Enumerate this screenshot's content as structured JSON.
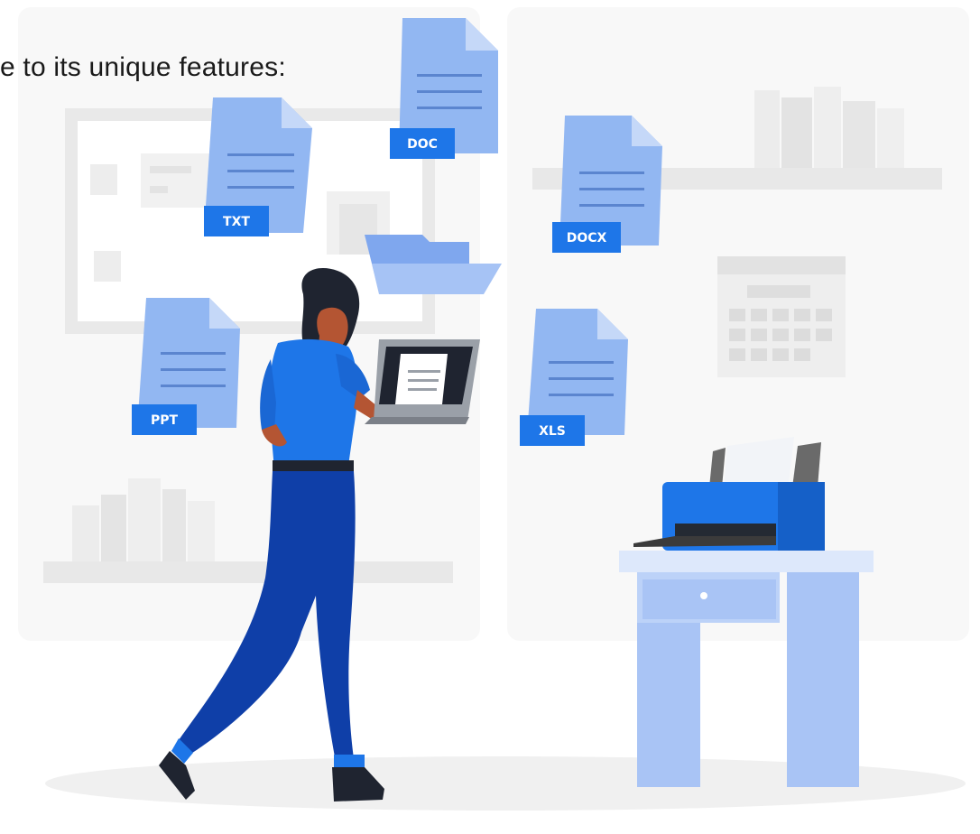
{
  "caption": "e to its unique features:",
  "files": [
    {
      "label": "TXT",
      "icon": "txt-file-icon"
    },
    {
      "label": "DOC",
      "icon": "doc-file-icon"
    },
    {
      "label": "DOCX",
      "icon": "docx-file-icon"
    },
    {
      "label": "PPT",
      "icon": "ppt-file-icon"
    },
    {
      "label": "XLS",
      "icon": "xls-file-icon"
    }
  ],
  "colors": {
    "blue": "#1e76e8",
    "blue_dark": "#0f3fa8",
    "doc_fill": "#92b7f2",
    "doc_fold": "#c5d8f8",
    "panel": "#f7f7f7",
    "light_gray": "#e6e6e6",
    "desk": "#a9c4f5",
    "desk_top": "#dde8fb"
  }
}
